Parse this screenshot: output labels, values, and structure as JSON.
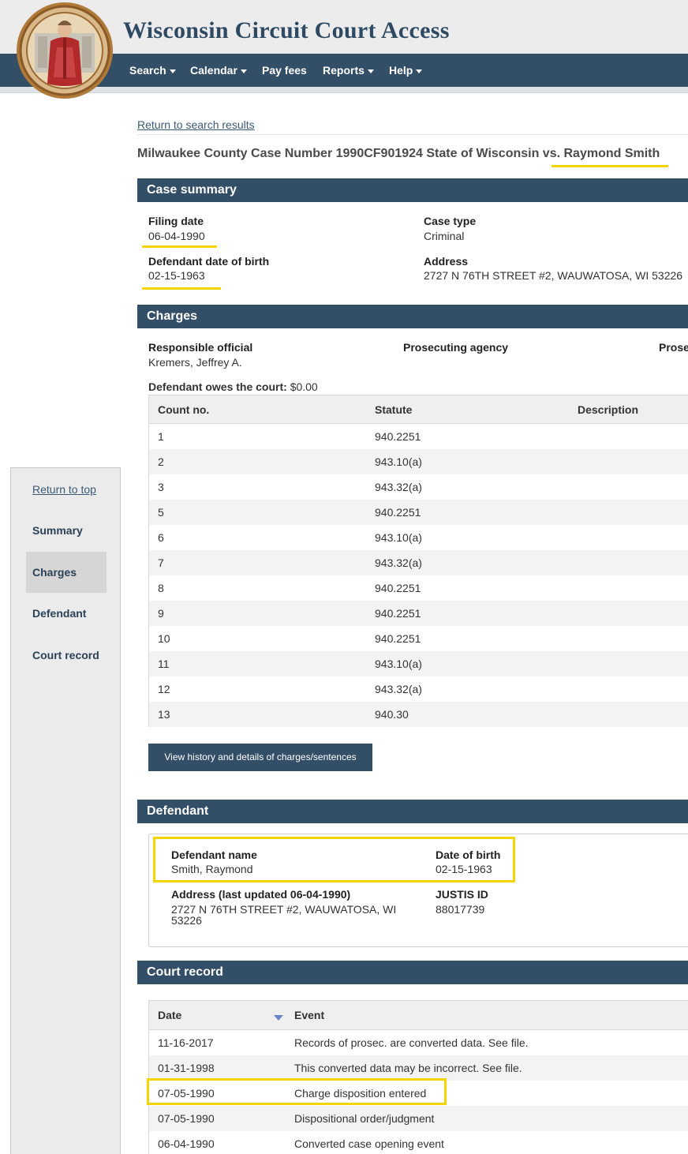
{
  "header": {
    "site_title": "Wisconsin Circuit Court Access",
    "nav": [
      "Search",
      "Calendar",
      "Pay fees",
      "Reports",
      "Help"
    ]
  },
  "sidebar": {
    "return_top": "Return to top",
    "items": [
      "Summary",
      "Charges",
      "Defendant",
      "Court record"
    ],
    "active": "Charges"
  },
  "main": {
    "back_link": "Return to search results",
    "case_title": "Milwaukee County Case Number 1990CF901924 State of Wisconsin vs. Raymond Smith",
    "summary": {
      "heading": "Case summary",
      "filing_date_label": "Filing date",
      "filing_date": "06-04-1990",
      "case_type_label": "Case type",
      "case_type": "Criminal",
      "dob_label": "Defendant date of birth",
      "dob": "02-15-1963",
      "address_label": "Address",
      "address": "2727 N 76TH STREET #2, WAUWATOSA, WI 53226"
    },
    "charges": {
      "heading": "Charges",
      "responsible_label": "Responsible official",
      "responsible": "Kremers, Jeffrey A.",
      "agency_label": "Prosecuting agency",
      "prosecutor_label": "Prose",
      "owes_label": "Defendant owes the court:",
      "owes": "$0.00",
      "columns": [
        "Count no.",
        "Statute",
        "Description"
      ],
      "rows": [
        {
          "count": "1",
          "statute": "940.2251"
        },
        {
          "count": "2",
          "statute": "943.10(a)"
        },
        {
          "count": "3",
          "statute": "943.32(a)"
        },
        {
          "count": "5",
          "statute": "940.2251"
        },
        {
          "count": "6",
          "statute": "943.10(a)"
        },
        {
          "count": "7",
          "statute": "943.32(a)"
        },
        {
          "count": "8",
          "statute": "940.2251"
        },
        {
          "count": "9",
          "statute": "940.2251"
        },
        {
          "count": "10",
          "statute": "940.2251"
        },
        {
          "count": "11",
          "statute": "943.10(a)"
        },
        {
          "count": "12",
          "statute": "943.32(a)"
        },
        {
          "count": "13",
          "statute": "940.30"
        }
      ],
      "button": "View history and details of charges/sentences"
    },
    "defendant": {
      "heading": "Defendant",
      "name_label": "Defendant name",
      "name": "Smith, Raymond",
      "dob_label": "Date of birth",
      "dob": "02-15-1963",
      "address_label": "Address (last updated 06-04-1990)",
      "address_line1": "2727 N 76TH STREET #2, WAUWATOSA, WI",
      "address_line2": "53226",
      "justis_label": "JUSTIS ID",
      "justis": "88017739"
    },
    "court_record": {
      "heading": "Court record",
      "columns": [
        "Date",
        "Event"
      ],
      "rows": [
        {
          "date": "11-16-2017",
          "event": "Records of prosec. are converted data. See file."
        },
        {
          "date": "01-31-1998",
          "event": "This converted data may be incorrect. See file."
        },
        {
          "date": "07-05-1990",
          "event": "Charge disposition entered"
        },
        {
          "date": "07-05-1990",
          "event": "Dispositional order/judgment"
        },
        {
          "date": "06-04-1990",
          "event": "Converted case opening event"
        }
      ]
    }
  },
  "colors": {
    "navy": "#334e67",
    "highlight": "#f5d400"
  }
}
